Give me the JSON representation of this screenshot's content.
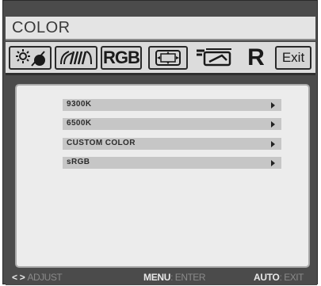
{
  "window": {
    "title": "COLOR"
  },
  "tabs": [
    {
      "name": "brightness-contrast",
      "icon": "brightness-contrast-icon"
    },
    {
      "name": "image-tuning",
      "icon": "image-tuning-icon"
    },
    {
      "name": "rgb",
      "label": "RGB",
      "icon": "rgb-icon"
    },
    {
      "name": "position",
      "icon": "screen-position-icon"
    },
    {
      "name": "osd-settings",
      "icon": "osd-setup-icon"
    },
    {
      "name": "reset",
      "label": "R",
      "icon": "reset-icon"
    },
    {
      "name": "exit",
      "label": "Exit",
      "icon": "exit-icon"
    }
  ],
  "menu": {
    "items": [
      {
        "label": "9300K"
      },
      {
        "label": "6500K"
      },
      {
        "label": "CUSTOM COLOR"
      },
      {
        "label": "sRGB"
      }
    ]
  },
  "footer": {
    "adjust_keys": "< >",
    "adjust_action": "ADJUST",
    "menu_key": "MENU",
    "menu_action": ": ENTER",
    "auto_key": "AUTO",
    "auto_action": ": EXIT"
  },
  "colors": {
    "frame": "#4b4b4b",
    "title_bg": "#e4e4e4",
    "panel_bg": "#ececec",
    "item_bg": "#c6c6c6",
    "accent_text": "#2c2c2c"
  }
}
